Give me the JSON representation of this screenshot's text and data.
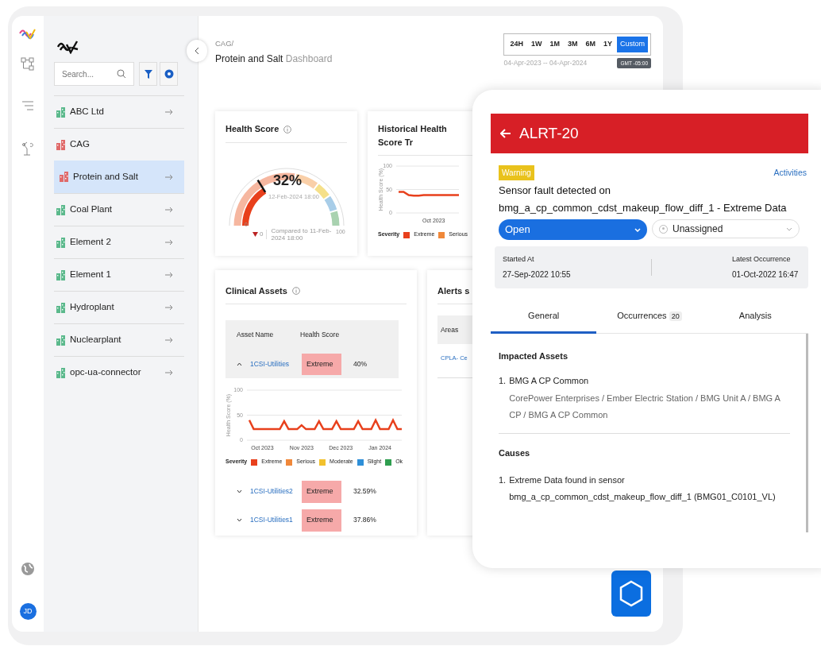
{
  "rail": {
    "avatar": "JD"
  },
  "sidebar": {
    "search": {
      "placeholder": "Search..."
    },
    "items": [
      {
        "label": "ABC Ltd",
        "color": "#5bb98c",
        "selected": false
      },
      {
        "label": "CAG",
        "color": "#e06a6a",
        "selected": false,
        "children": [
          {
            "label": "Protein and Salt",
            "color": "#e06a6a",
            "selected": true
          }
        ]
      },
      {
        "label": "Coal Plant",
        "color": "#5bb98c",
        "selected": false
      },
      {
        "label": "Element 2",
        "color": "#5bb98c",
        "selected": false
      },
      {
        "label": "Element 1",
        "color": "#5bb98c",
        "selected": false
      },
      {
        "label": "Hydroplant",
        "color": "#5bb98c",
        "selected": false
      },
      {
        "label": "Nuclearplant",
        "color": "#5bb98c",
        "selected": false
      },
      {
        "label": "opc-ua-connector",
        "color": "#5bb98c",
        "selected": false
      }
    ]
  },
  "header": {
    "breadcrumb": "CAG/",
    "title": "Protein and Salt",
    "subtitle": "Dashboard",
    "ranges": [
      {
        "label": "24H",
        "selected": false
      },
      {
        "label": "1W",
        "selected": false
      },
      {
        "label": "1M",
        "selected": false
      },
      {
        "label": "3M",
        "selected": false
      },
      {
        "label": "6M",
        "selected": false
      },
      {
        "label": "1Y",
        "selected": false
      },
      {
        "label": "Custom",
        "selected": true
      }
    ],
    "date_range": "04-Apr-2023 -- 04-Apr-2024",
    "timezone": "GMT -05:00"
  },
  "health_score": {
    "title": "Health Score",
    "value": "32%",
    "timestamp": "12-Feb-2024 18:00",
    "min": "0",
    "max": "100",
    "change": "0",
    "decreased": true,
    "compared": "Compared to 11-Feb-2024 18:00"
  },
  "historical": {
    "title": "Historical Health Score Tr",
    "chart_data": {
      "type": "line",
      "ylabel": "Health Score (%)",
      "ylim": [
        0,
        100
      ],
      "yticks": [
        0,
        50,
        100
      ],
      "categories": [
        null,
        null,
        null,
        null,
        null,
        null,
        null,
        "Oct 2023",
        null,
        null,
        null,
        null,
        null
      ],
      "series": [
        {
          "color": "#e8401c",
          "values": [
            45,
            45,
            38,
            37,
            37,
            38,
            38,
            38,
            38,
            38,
            38,
            38,
            38
          ]
        }
      ]
    },
    "legend": {
      "title": "Severity",
      "items": [
        {
          "label": "Extreme",
          "color": "#e8401c"
        },
        {
          "label": "Serious",
          "color": "#f0883a"
        }
      ]
    }
  },
  "clinical_assets": {
    "title": "Clinical Assets",
    "columns": [
      "Asset Name",
      "Health Score"
    ],
    "rows": [
      {
        "name": "1CSI-Utilities",
        "severity": "Extreme",
        "score": "40%",
        "expanded": true,
        "chart_data": {
          "type": "line",
          "ylabel": "Health Score (%)",
          "ylim": [
            0,
            100
          ],
          "yticks": [
            0,
            50,
            100
          ],
          "categories": [
            null,
            null,
            null,
            "Oct 2023",
            null,
            null,
            null,
            null,
            null,
            null,
            null,
            null,
            "Nov 2023",
            null,
            null,
            null,
            null,
            null,
            null,
            null,
            null,
            "Dec 2023",
            null,
            null,
            null,
            null,
            null,
            null,
            null,
            null,
            "Jan 2024",
            null,
            null,
            null,
            null,
            null
          ],
          "series": [
            {
              "color": "#e8401c",
              "values": [
                40,
                22,
                22,
                22,
                22,
                22,
                22,
                22,
                38,
                22,
                22,
                22,
                30,
                22,
                22,
                22,
                38,
                22,
                22,
                22,
                38,
                22,
                22,
                22,
                22,
                38,
                22,
                22,
                22,
                40,
                22,
                22,
                22,
                40,
                22,
                22
              ]
            }
          ]
        },
        "legend": {
          "title": "Severity",
          "items": [
            {
              "label": "Extreme",
              "color": "#e8401c"
            },
            {
              "label": "Serious",
              "color": "#f0883a"
            },
            {
              "label": "Moderate",
              "color": "#f2c12e"
            },
            {
              "label": "Slight",
              "color": "#2e8fd8"
            },
            {
              "label": "Ok",
              "color": "#2f9e4f"
            }
          ]
        }
      },
      {
        "name": "1CSI-Utilities2",
        "severity": "Extreme",
        "score": "32.59%",
        "expanded": false
      },
      {
        "name": "1CSI-Utilities1",
        "severity": "Extreme",
        "score": "37.86%",
        "expanded": false
      }
    ]
  },
  "alerts": {
    "title": "Alerts s",
    "columns": [
      "Areas"
    ],
    "rows": [
      "CPLA- Ce"
    ]
  },
  "alert_panel": {
    "id": "ALRT-20",
    "level": "Warning",
    "activities": "Activities",
    "title": "Sensor fault detected on bmg_a_cp_common_cdst_makeup_flow_diff_1 - Extreme Data",
    "status": "Open",
    "assignee": "Unassigned",
    "started_label": "Started At",
    "started": "27-Sep-2022 10:55",
    "latest_label": "Latest Occurrence",
    "latest": "01-Oct-2022 16:47",
    "tabs": [
      {
        "label": "General",
        "selected": true
      },
      {
        "label": "Occurrences",
        "count": "20",
        "selected": false
      },
      {
        "label": "Analysis",
        "selected": false
      }
    ],
    "impacted_title": "Impacted Assets",
    "impacted": [
      {
        "number": "1.",
        "name": "BMG A CP Common",
        "path": "CorePower Enterprises / Ember Electric Station / BMG Unit A / BMG A CP / BMG A CP Common"
      }
    ],
    "causes_title": "Causes",
    "causes": [
      {
        "number": "1.",
        "text": "Extreme Data found in sensor bmg_a_cp_common_cdst_makeup_flow_diff_1 (BMG01_C0101_VL)"
      }
    ]
  }
}
